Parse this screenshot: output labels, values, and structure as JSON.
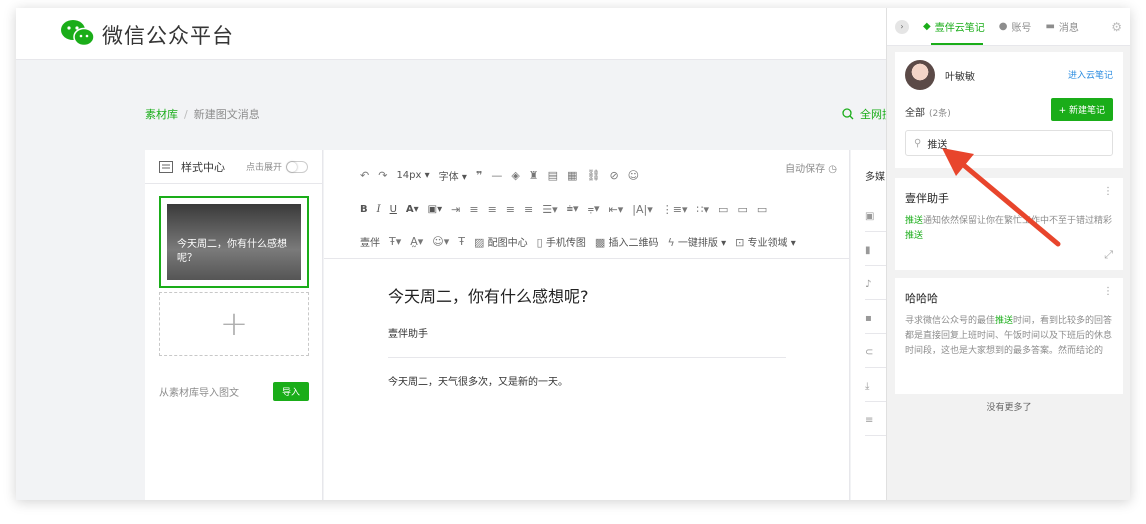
{
  "app": {
    "title": "微信公众平台"
  },
  "breadcrumb": {
    "root": "素材库",
    "separator": "/",
    "current": "新建图文消息"
  },
  "header_search": {
    "label": "全网搜"
  },
  "style_center": {
    "title": "样式中心",
    "expand_label": "点击展开"
  },
  "article_card": {
    "title": "今天周二，你有什么感想呢？"
  },
  "import_row": {
    "label": "从素材库导入图文",
    "button": "导入"
  },
  "editor": {
    "autosave": "自动保存",
    "toolbar_row1": {
      "font_size": "14px",
      "font_family": "字体"
    },
    "toolbar_row3": {
      "yiban": "壹伴",
      "image_center": "配图中心",
      "phone_to_image": "手机传图",
      "qr_code": "插入二维码",
      "one_click_layout": "一键排版",
      "pro_domain": "专业领域"
    },
    "doc": {
      "title": "今天周二，你有什么感想呢?",
      "author": "壹伴助手",
      "body": "今天周二，天气很多次，又是新的一天。"
    }
  },
  "media_panel": {
    "title": "多媒"
  },
  "cloud": {
    "tabs": [
      {
        "label": "壹伴云笔记",
        "active": true
      },
      {
        "label": "账号",
        "active": false
      },
      {
        "label": "消息",
        "active": false
      }
    ],
    "user": {
      "name": "叶敏敏",
      "enter_link": "进入云笔记"
    },
    "filter": {
      "label": "全部",
      "count": "(2条)"
    },
    "new_note_button": "+ 新建笔记",
    "search": {
      "value": "推送"
    },
    "notes": [
      {
        "title": "壹伴助手",
        "body_hl": "推送",
        "body_a": "通知依然保留让你在繁忙工作中不至于错过精彩",
        "body_hl2": "推送"
      },
      {
        "title": "哈哈哈",
        "body_a": "寻求微信公众号的最佳",
        "body_hl": "推送",
        "body_b": "时间，看到比较多的回答都是直接回复上班时间、午饭时间以及下班后的休息时间段，这也是大家想到的最多答案。然而结论的"
      }
    ],
    "no_more": "没有更多了"
  },
  "colors": {
    "accent": "#1aad19",
    "link": "#2d8de0",
    "arrow": "#e8452c"
  }
}
